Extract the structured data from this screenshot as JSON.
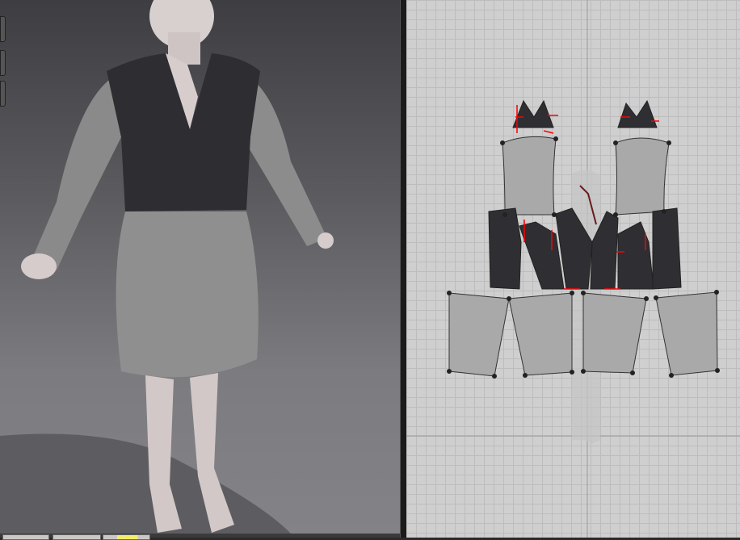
{
  "colors": {
    "viewport_bg_top": "#3e3e42",
    "viewport_bg_bottom": "#838387",
    "pattern_bg": "#cfcfcf",
    "fabric_light": "#a8a8a8",
    "fabric_dark": "#2f2f33",
    "seam_marker": "#ff0000",
    "active_tab": "#f3ee6a"
  },
  "icons": [
    "avatar-3d",
    "pattern-piece",
    "seam-marker"
  ]
}
